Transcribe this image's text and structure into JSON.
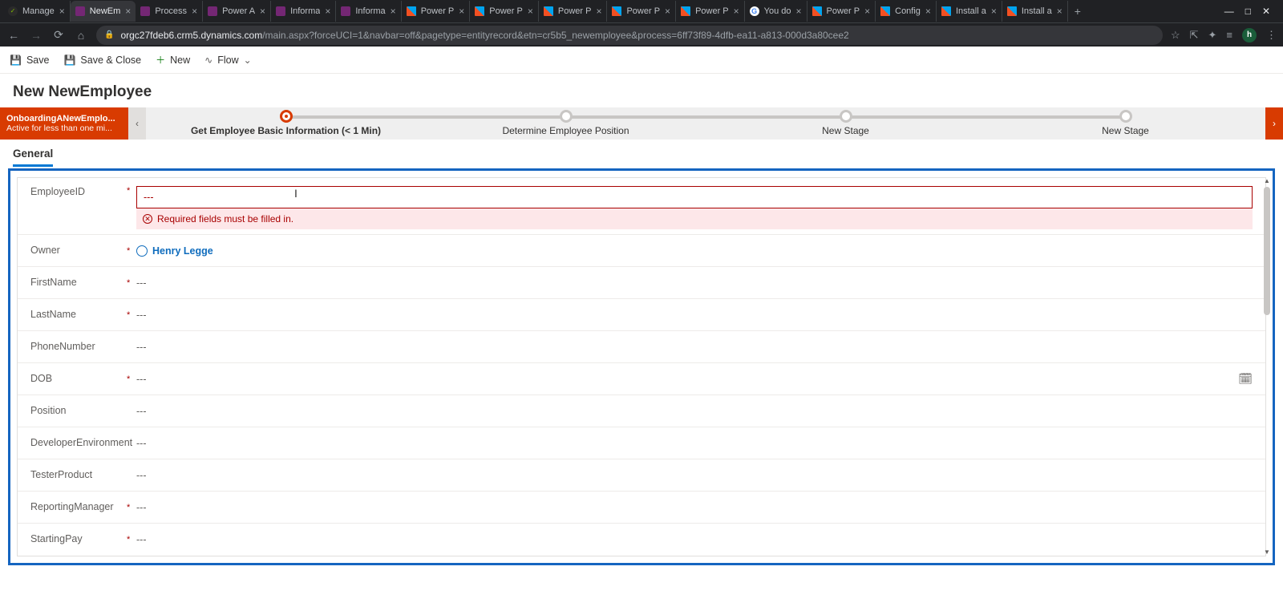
{
  "browser": {
    "tabs": [
      {
        "title": "Manage",
        "fav": "fav-feather",
        "active": false
      },
      {
        "title": "NewEm",
        "fav": "fav-purple",
        "active": true
      },
      {
        "title": "Process",
        "fav": "fav-purple",
        "active": false
      },
      {
        "title": "Power A",
        "fav": "fav-purple",
        "active": false
      },
      {
        "title": "Informa",
        "fav": "fav-purple",
        "active": false
      },
      {
        "title": "Informa",
        "fav": "fav-purple",
        "active": false
      },
      {
        "title": "Power P",
        "fav": "fav-ms",
        "active": false
      },
      {
        "title": "Power P",
        "fav": "fav-ms",
        "active": false
      },
      {
        "title": "Power P",
        "fav": "fav-ms",
        "active": false
      },
      {
        "title": "Power P",
        "fav": "fav-ms",
        "active": false
      },
      {
        "title": "Power P",
        "fav": "fav-ms",
        "active": false
      },
      {
        "title": "You do",
        "fav": "fav-g",
        "active": false
      },
      {
        "title": "Power P",
        "fav": "fav-ms",
        "active": false
      },
      {
        "title": "Config",
        "fav": "fav-ms",
        "active": false
      },
      {
        "title": "Install a",
        "fav": "fav-ms",
        "active": false
      },
      {
        "title": "Install a",
        "fav": "fav-ms",
        "active": false
      }
    ],
    "url_domain": "orgc27fdeb6.crm5.dynamics.com",
    "url_path": "/main.aspx?forceUCI=1&navbar=off&pagetype=entityrecord&etn=cr5b5_newemployee&process=6ff73f89-4dfb-ea11-a813-000d3a80cee2",
    "avatar_letter": "h"
  },
  "commands": {
    "save": "Save",
    "save_close": "Save & Close",
    "new": "New",
    "flow": "Flow"
  },
  "page_title": "New NewEmployee",
  "process": {
    "name": "OnboardingANewEmplo...",
    "status": "Active for less than one mi...",
    "stages": [
      {
        "label": "Get Employee Basic Information  (< 1 Min)",
        "active": true
      },
      {
        "label": "Determine Employee Position",
        "active": false
      },
      {
        "label": "New Stage",
        "active": false
      },
      {
        "label": "New Stage",
        "active": false
      }
    ]
  },
  "tab_general": "General",
  "error_text": "Required fields must be filled in.",
  "empty_placeholder": "---",
  "owner_name": "Henry Legge",
  "fields": {
    "employeeid": {
      "label": "EmployeeID",
      "required": true
    },
    "owner": {
      "label": "Owner",
      "required": true
    },
    "firstname": {
      "label": "FirstName",
      "required": true
    },
    "lastname": {
      "label": "LastName",
      "required": true
    },
    "phonenumber": {
      "label": "PhoneNumber",
      "required": false
    },
    "dob": {
      "label": "DOB",
      "required": true
    },
    "position": {
      "label": "Position",
      "required": false
    },
    "devenv": {
      "label": "DeveloperEnvironment",
      "required": false
    },
    "testerproduct": {
      "label": "TesterProduct",
      "required": false
    },
    "reportingmanager": {
      "label": "ReportingManager",
      "required": true
    },
    "startingpay": {
      "label": "StartingPay",
      "required": true
    }
  }
}
